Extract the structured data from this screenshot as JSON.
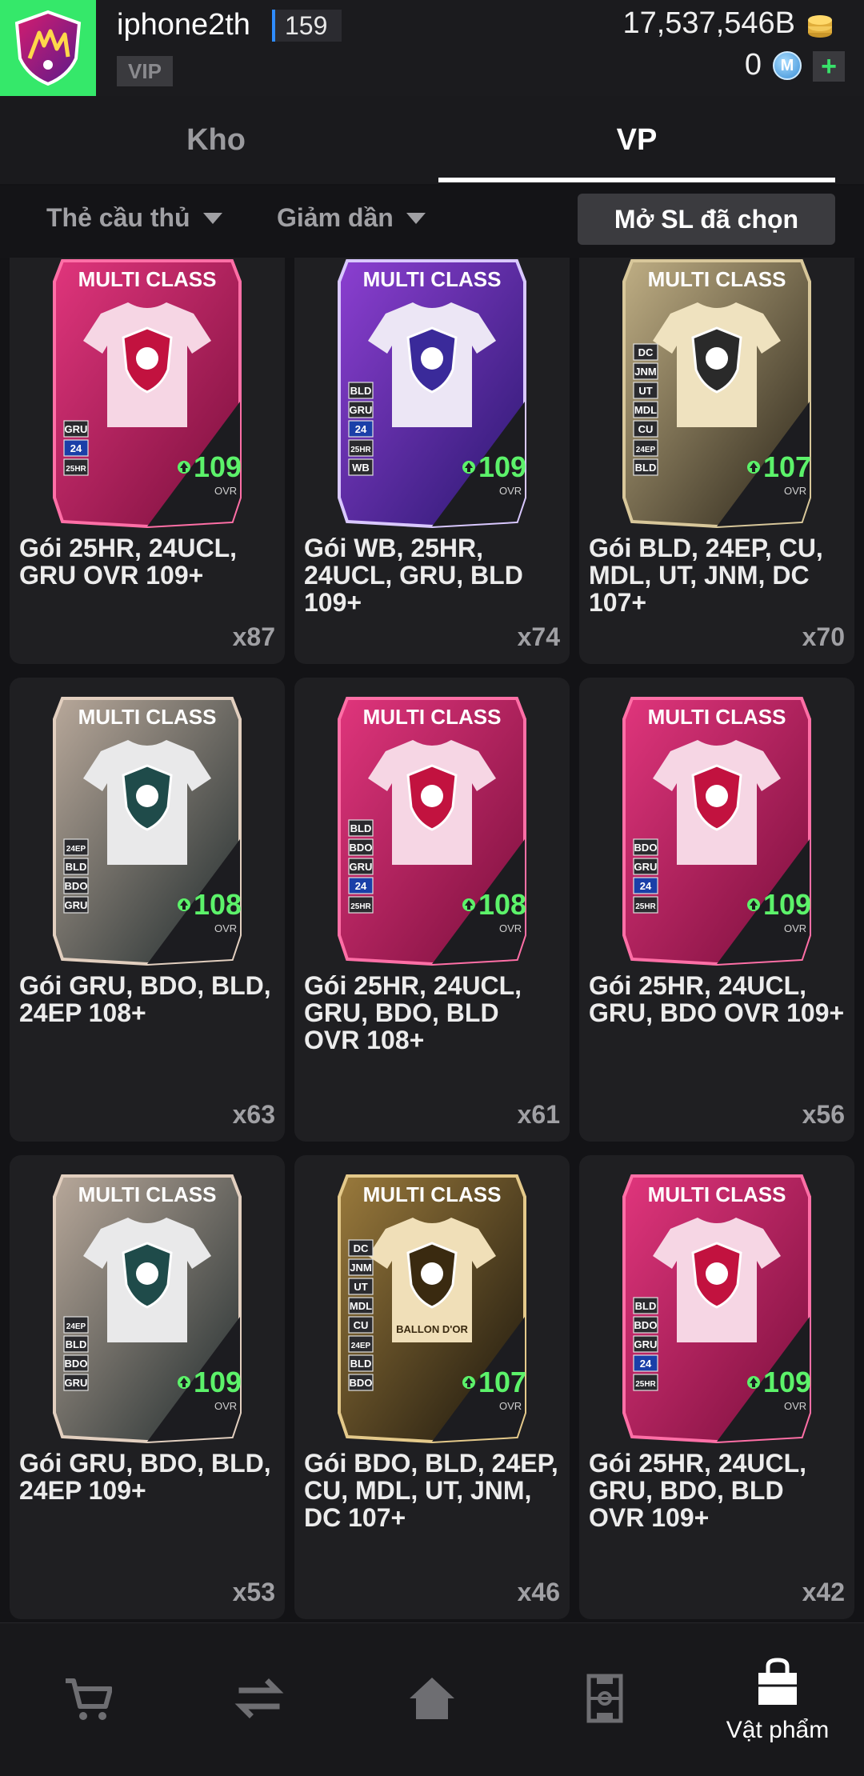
{
  "header": {
    "username": "iphone2th",
    "level": "159",
    "vip": "VIP",
    "coins": "17,537,546B",
    "mpoints": "0",
    "m_icon_letter": "M",
    "plus": "+"
  },
  "tabs": [
    {
      "label": "Kho",
      "active": false
    },
    {
      "label": "VP",
      "active": true
    }
  ],
  "filters": {
    "type": "Thẻ cầu thủ",
    "sort": "Giảm dần",
    "open_selected": "Mở SL đã chọn"
  },
  "items": [
    {
      "name": "Gói 25HR, 24UCL, GRU OVR 109+",
      "qty": "x87",
      "title": "MULTI CLASS",
      "ovr": "109",
      "ovr_label": "OVR",
      "theme": "pink",
      "badges": [
        "GRU",
        "24",
        "25HR"
      ]
    },
    {
      "name": "Gói WB, 25HR, 24UCL, GRU, BLD 109+",
      "qty": "x74",
      "title": "MULTI CLASS",
      "ovr": "109",
      "ovr_label": "OVR",
      "theme": "purple",
      "badges": [
        "BLD",
        "GRU",
        "24",
        "25HR",
        "WB"
      ]
    },
    {
      "name": "Gói BLD, 24EP, CU, MDL, UT, JNM, DC 107+",
      "qty": "x70",
      "title": "MULTI CLASS",
      "ovr": "107",
      "ovr_label": "OVR",
      "theme": "gold",
      "badges": [
        "DC",
        "JNM",
        "UT",
        "MDL",
        "CU",
        "24EP",
        "BLD"
      ]
    },
    {
      "name": "Gói GRU, BDO, BLD, 24EP 108+",
      "qty": "x63",
      "title": "MULTI CLASS",
      "ovr": "108",
      "ovr_label": "OVR",
      "theme": "silver",
      "badges": [
        "24EP",
        "BLD",
        "BDO",
        "GRU"
      ]
    },
    {
      "name": "Gói 25HR, 24UCL, GRU, BDO, BLD OVR 108+",
      "qty": "x61",
      "title": "MULTI CLASS",
      "ovr": "108",
      "ovr_label": "OVR",
      "theme": "pink",
      "badges": [
        "BLD",
        "BDO",
        "GRU",
        "24",
        "25HR"
      ]
    },
    {
      "name": "Gói 25HR, 24UCL, GRU, BDO OVR 109+",
      "qty": "x56",
      "title": "MULTI CLASS",
      "ovr": "109",
      "ovr_label": "OVR",
      "theme": "pink",
      "badges": [
        "BDO",
        "GRU",
        "24",
        "25HR"
      ]
    },
    {
      "name": "Gói GRU, BDO, BLD, 24EP 109+",
      "qty": "x53",
      "title": "MULTI CLASS",
      "ovr": "109",
      "ovr_label": "OVR",
      "theme": "silver",
      "badges": [
        "24EP",
        "BLD",
        "BDO",
        "GRU"
      ]
    },
    {
      "name": "Gói BDO, BLD, 24EP, CU, MDL, UT, JNM, DC 107+",
      "qty": "x46",
      "title": "MULTI CLASS",
      "ovr": "107",
      "ovr_label": "OVR",
      "theme": "ballon",
      "badges": [
        "DC",
        "JNM",
        "UT",
        "MDL",
        "CU",
        "24EP",
        "BLD",
        "BDO"
      ],
      "crest_text": "BALLON D'OR"
    },
    {
      "name": "Gói 25HR, 24UCL, GRU, BDO, BLD OVR 109+",
      "qty": "x42",
      "title": "MULTI CLASS",
      "ovr": "109",
      "ovr_label": "OVR",
      "theme": "pink",
      "badges": [
        "BLD",
        "BDO",
        "GRU",
        "24",
        "25HR"
      ]
    }
  ],
  "bottom_nav": [
    {
      "icon": "cart-icon",
      "label": "",
      "active": false
    },
    {
      "icon": "transfer-icon",
      "label": "",
      "active": false
    },
    {
      "icon": "home-icon",
      "label": "",
      "active": false
    },
    {
      "icon": "pitch-icon",
      "label": "",
      "active": false
    },
    {
      "icon": "bag-icon",
      "label": "Vật phẩm",
      "active": true
    }
  ],
  "colors": {
    "accent_green": "#35e86a",
    "ovr_green": "#5cf26a",
    "tab_active": "#ffffff",
    "level_bar": "#2f8cff"
  }
}
